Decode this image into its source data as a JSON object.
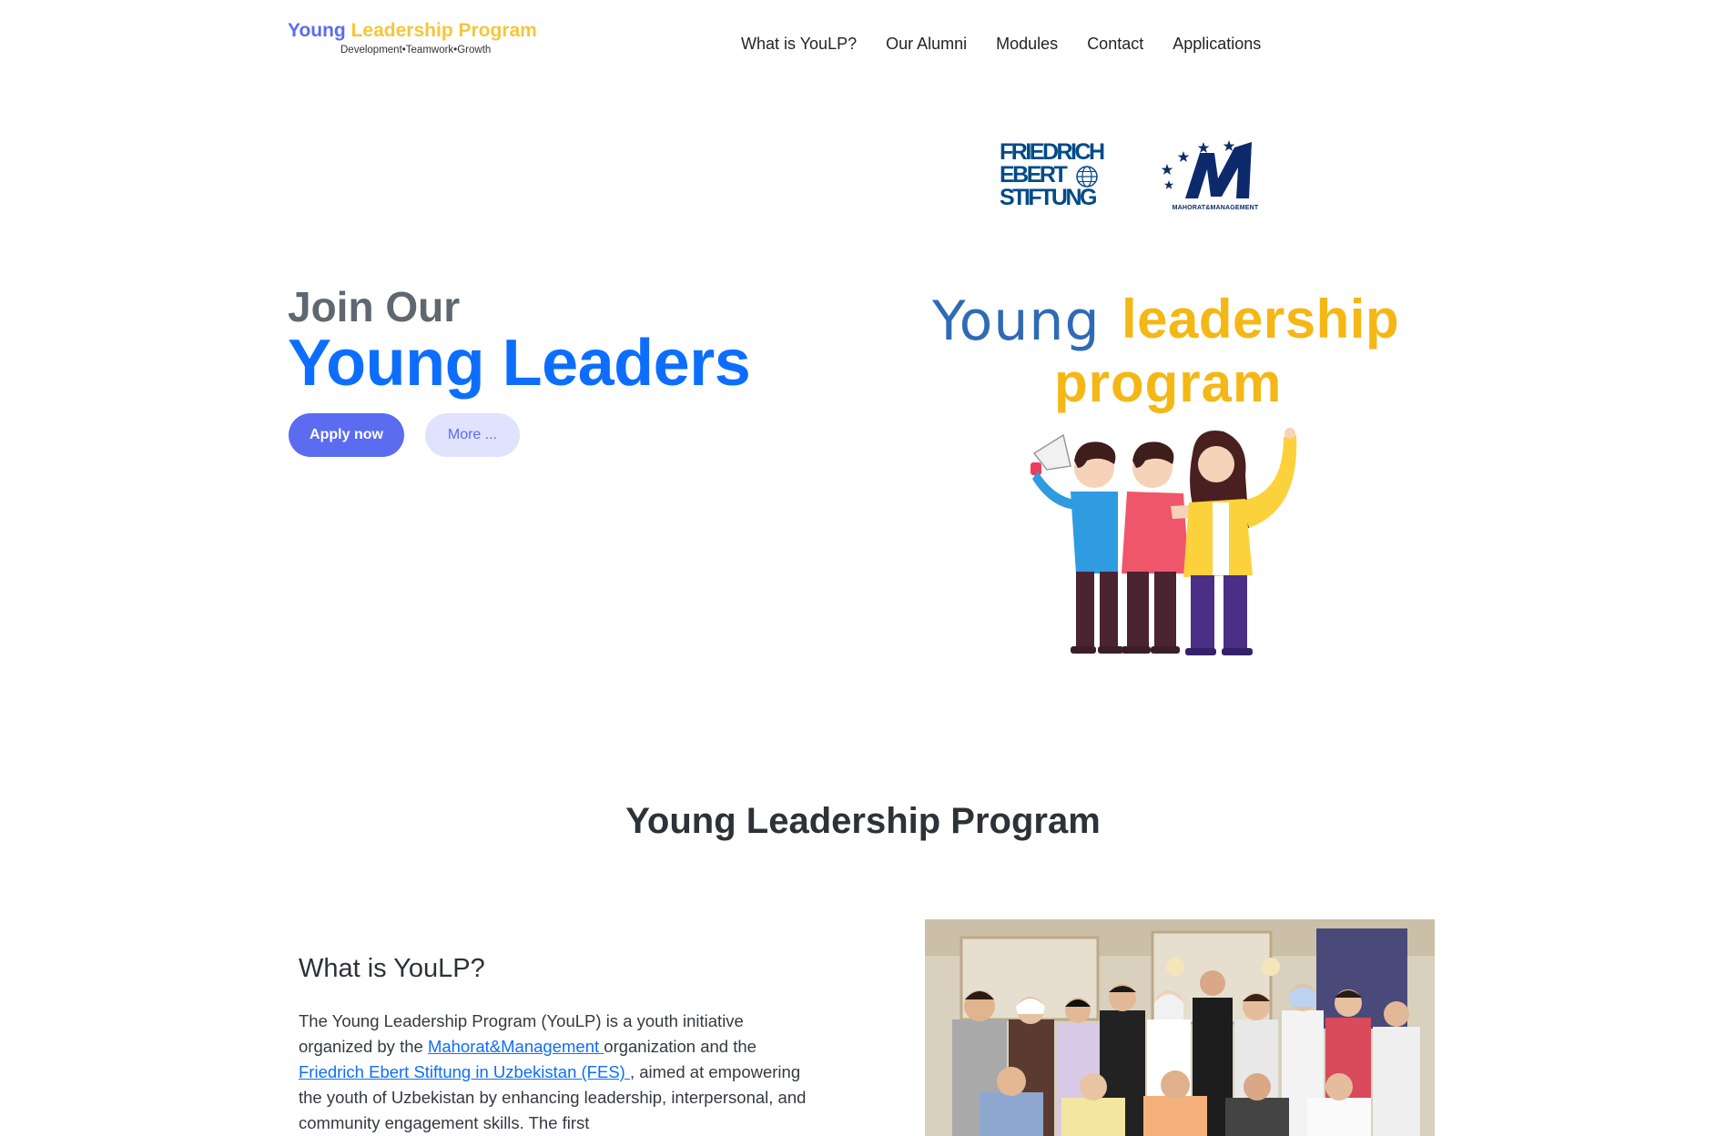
{
  "brand": {
    "title_part1": "Young",
    "title_part2": "Leadership Program",
    "tagline": "Development•Teamwork•Growth",
    "color_primary": "#5b6cf0",
    "color_accent": "#f5c63a"
  },
  "nav": {
    "items": [
      {
        "label": "What is YouLP?"
      },
      {
        "label": "Our Alumni"
      },
      {
        "label": "Modules"
      },
      {
        "label": "Contact"
      },
      {
        "label": "Applications"
      }
    ]
  },
  "partners": {
    "fes": {
      "line1": "FRIEDRICH",
      "line2": "EBERT",
      "line3": "STIFTUNG"
    },
    "mm": {
      "label": "MAHORAT&MANAGEMENT"
    }
  },
  "hero": {
    "title_small": "Join Our",
    "title_big": "Young Leaders",
    "apply_label": "Apply now",
    "more_label": "More ...",
    "art": {
      "word_young": "Young",
      "word_leadership": "leadership",
      "word_program": "program"
    }
  },
  "section": {
    "title": "Young Leadership Program"
  },
  "about": {
    "heading": "What is YouLP?",
    "text_1": "The Young Leadership Program (YouLP) is a youth initiative organized by the ",
    "link_1": "Mahorat&Management ",
    "text_2": "organization and the ",
    "link_2": "Friedrich Ebert Stiftung in Uzbekistan (FES) ",
    "text_3": ", aimed at empowering the youth of Uzbekistan by enhancing leadership, interpersonal, and community engagement skills. The first"
  }
}
